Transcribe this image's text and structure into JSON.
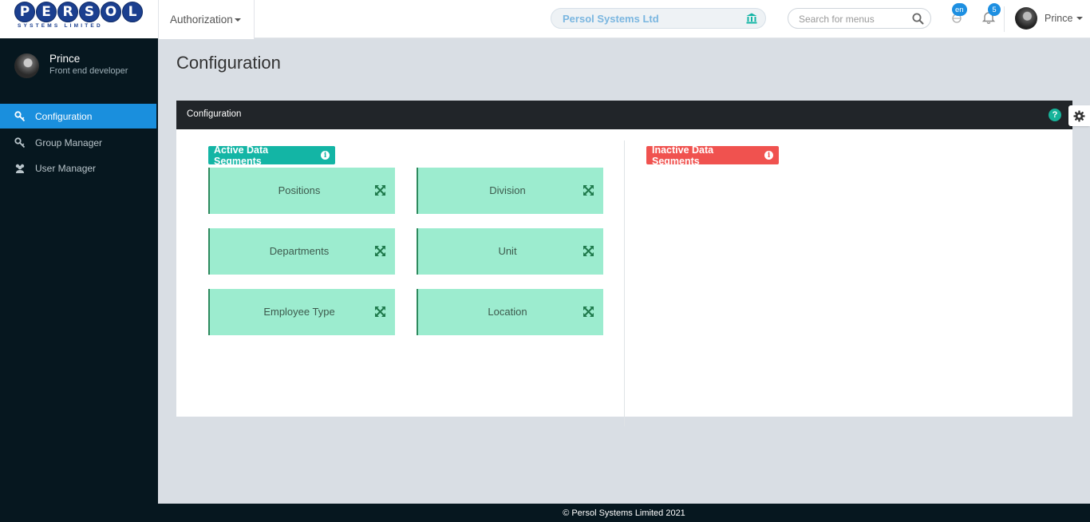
{
  "logo": {
    "letters": [
      "P",
      "E",
      "R",
      "S",
      "O",
      "L"
    ],
    "subtitle": "SYSTEMS LIMITED"
  },
  "header": {
    "module": "Authorization",
    "company": "Persol Systems Ltd",
    "search": {
      "placeholder": "Search for menus",
      "value": ""
    },
    "lang_badge": "en",
    "notif_count": "5",
    "user_name": "Prince"
  },
  "sidebar": {
    "profile": {
      "name": "Prince",
      "role": "Front end developer"
    },
    "items": [
      {
        "label": "Configuration",
        "icon": "key-icon",
        "active": true
      },
      {
        "label": "Group Manager",
        "icon": "key-icon",
        "active": false
      },
      {
        "label": "User Manager",
        "icon": "users-icon",
        "active": false
      }
    ]
  },
  "main": {
    "page_title": "Configuration",
    "panel_title": "Configuration",
    "active_label": "Active Data Segments",
    "inactive_label": "Inactive Data Segments",
    "active_segments": [
      "Positions",
      "Division",
      "Departments",
      "Unit",
      "Employee Type",
      "Location"
    ],
    "inactive_segments": []
  },
  "footer": {
    "text": "© Persol Systems Limited 2021"
  },
  "colors": {
    "sidebar_bg": "#06171f",
    "active_nav": "#1a8fdd",
    "active_label": "#13b5a5",
    "inactive_label": "#f0524f",
    "segment_card": "#9ceccf",
    "panel_header": "#212529"
  }
}
